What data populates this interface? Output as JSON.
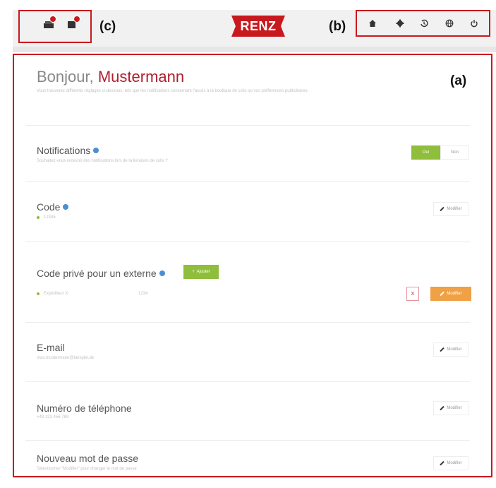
{
  "callouts": {
    "a": "(a)",
    "b": "(b)",
    "c": "(c)"
  },
  "header": {
    "logo": "RENZ",
    "nav_icons": [
      "home-icon",
      "gear-icon",
      "history-icon",
      "globe-icon",
      "power-icon"
    ]
  },
  "status_icons": [
    "tray-icon",
    "mailbox-icon"
  ],
  "colors": {
    "brand": "#c8191e",
    "name": "#b01f2e",
    "green": "#8fbd3c",
    "orange": "#f0a045",
    "info": "#4b8fd1"
  },
  "greeting": {
    "prefix": "Bonjour,",
    "name": "Mustermann",
    "subtitle": "Vous trouverez différents réglages ci-dessous, tels que les notifications concernant l'accès à la boutique de colis ou vos préférences publicitaires."
  },
  "notifications": {
    "title": "Notifications",
    "subtitle": "Souhaitez-vous recevoir des notifications lors de la livraison de colis ?",
    "on_label": "Oui",
    "off_label": "Non"
  },
  "code": {
    "title": "Code",
    "value": "12345",
    "edit_label": "Modifier"
  },
  "private_code": {
    "title": "Code privé pour un externe",
    "add_label": "Ajouter",
    "entry_name": "Expéditeur X",
    "entry_code": "1234",
    "delete_label": "X",
    "edit_label": "Modifier"
  },
  "email": {
    "title": "E-mail",
    "value": "max.mustermann@beispiel.de",
    "edit_label": "Modifier"
  },
  "phone": {
    "title": "Numéro de téléphone",
    "value": "+49 123 456 789",
    "edit_label": "Modifier"
  },
  "password": {
    "title": "Nouveau mot de passe",
    "subtitle": "Sélectionner \"Modifier\" pour changer le mot de passe",
    "edit_label": "Modifier"
  }
}
